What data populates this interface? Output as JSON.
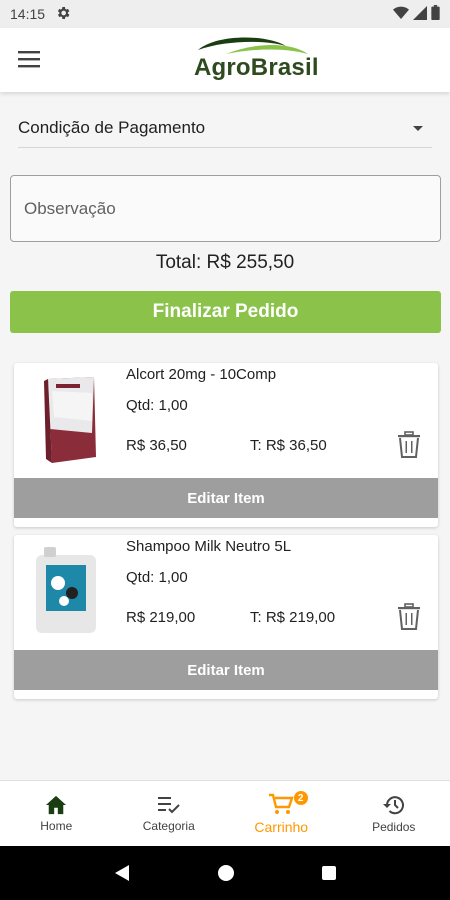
{
  "status_bar": {
    "time": "14:15"
  },
  "header": {
    "logo_text": "AgroBrasil"
  },
  "payment": {
    "label": "Condição de Pagamento"
  },
  "observation": {
    "placeholder": "Observação"
  },
  "total": {
    "text": "Total: R$  255,50"
  },
  "finalize_label": "Finalizar Pedido",
  "items": [
    {
      "name": "Alcort 20mg - 10Comp",
      "qty": "Qtd:  1,00",
      "price": "R$  36,50",
      "subtotal": "T: R$  36,50",
      "edit_label": "Editar Item"
    },
    {
      "name": "Shampoo Milk Neutro 5L",
      "qty": "Qtd:  1,00",
      "price": "R$  219,00",
      "subtotal": "T: R$  219,00",
      "edit_label": "Editar Item"
    }
  ],
  "bottom_nav": {
    "items": [
      {
        "label": "Home",
        "icon": "home-icon"
      },
      {
        "label": "Categoria",
        "icon": "checklist-icon"
      },
      {
        "label": "Carrinho",
        "icon": "cart-icon",
        "badge": "2"
      },
      {
        "label": "Pedidos",
        "icon": "history-icon"
      }
    ]
  },
  "colors": {
    "accent": "#8bc34a",
    "active_nav": "#ff9800",
    "edit_button": "#9e9e9e"
  }
}
